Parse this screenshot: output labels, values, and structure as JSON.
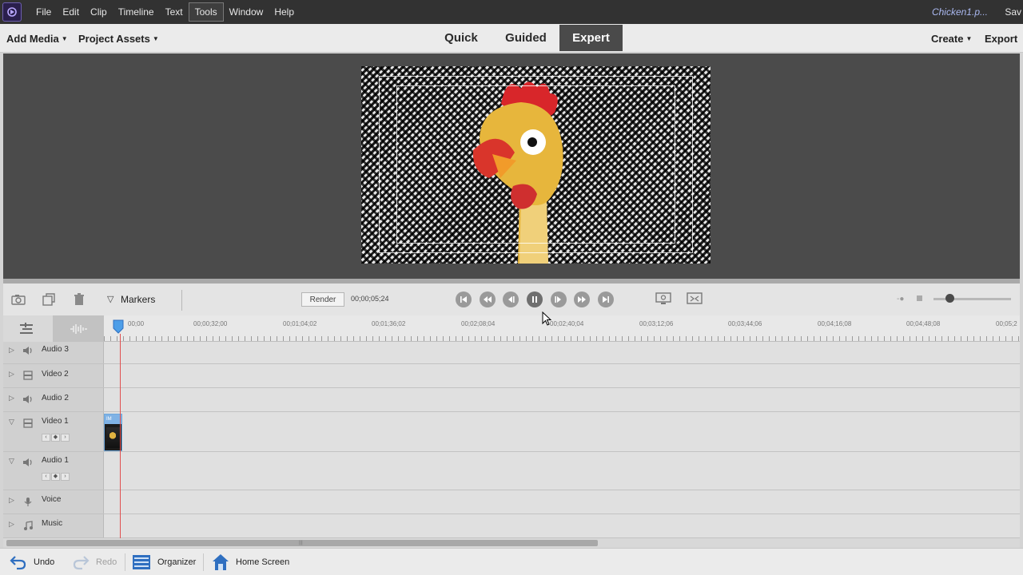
{
  "menubar": {
    "items": [
      {
        "label": "File",
        "active": false
      },
      {
        "label": "Edit",
        "active": false
      },
      {
        "label": "Clip",
        "active": false
      },
      {
        "label": "Timeline",
        "active": false
      },
      {
        "label": "Text",
        "active": false
      },
      {
        "label": "Tools",
        "active": true
      },
      {
        "label": "Window",
        "active": false
      },
      {
        "label": "Help",
        "active": false
      }
    ],
    "doc_title": "Chicken1.p...",
    "save_label": "Sav"
  },
  "topbar": {
    "add_media": "Add Media",
    "project_assets": "Project Assets",
    "modes": [
      {
        "label": "Quick",
        "active": false
      },
      {
        "label": "Guided",
        "active": false
      },
      {
        "label": "Expert",
        "active": true
      }
    ],
    "create": "Create",
    "export": "Export"
  },
  "timeline_toolbar": {
    "markers_label": "Markers",
    "render_label": "Render",
    "timecode": "00;00;05;24"
  },
  "ruler": {
    "ticks": [
      "00;00",
      "00;00;32;00",
      "00;01;04;02",
      "00;01;36;02",
      "00;02;08;04",
      "00;02;40;04",
      "00;03;12;06",
      "00;03;44;06",
      "00;04;16;08",
      "00;04;48;08",
      "00;05;2"
    ]
  },
  "tracks": [
    {
      "label": "Audio 3",
      "type": "audio",
      "expanded": false
    },
    {
      "label": "Video 2",
      "type": "video",
      "expanded": false
    },
    {
      "label": "Audio 2",
      "type": "audio",
      "expanded": false
    },
    {
      "label": "Video 1",
      "type": "video",
      "expanded": true
    },
    {
      "label": "Audio 1",
      "type": "audio",
      "expanded": true
    },
    {
      "label": "Voice",
      "type": "voice",
      "expanded": false
    },
    {
      "label": "Music",
      "type": "music",
      "expanded": false
    }
  ],
  "clip": {
    "badge": "IM"
  },
  "bottombar": {
    "undo": "Undo",
    "redo": "Redo",
    "organizer": "Organizer",
    "home_screen": "Home Screen"
  },
  "colors": {
    "menubar_bg": "#323232",
    "accent_blue": "#2f6fc0",
    "playhead": "#e05050",
    "doc_title": "#aab8f0"
  },
  "icons": {
    "app_logo": "premiere-elements-logo-icon",
    "undo": "undo-arrow-icon",
    "redo": "redo-arrow-icon",
    "organizer": "organizer-grid-icon",
    "home": "home-icon"
  }
}
